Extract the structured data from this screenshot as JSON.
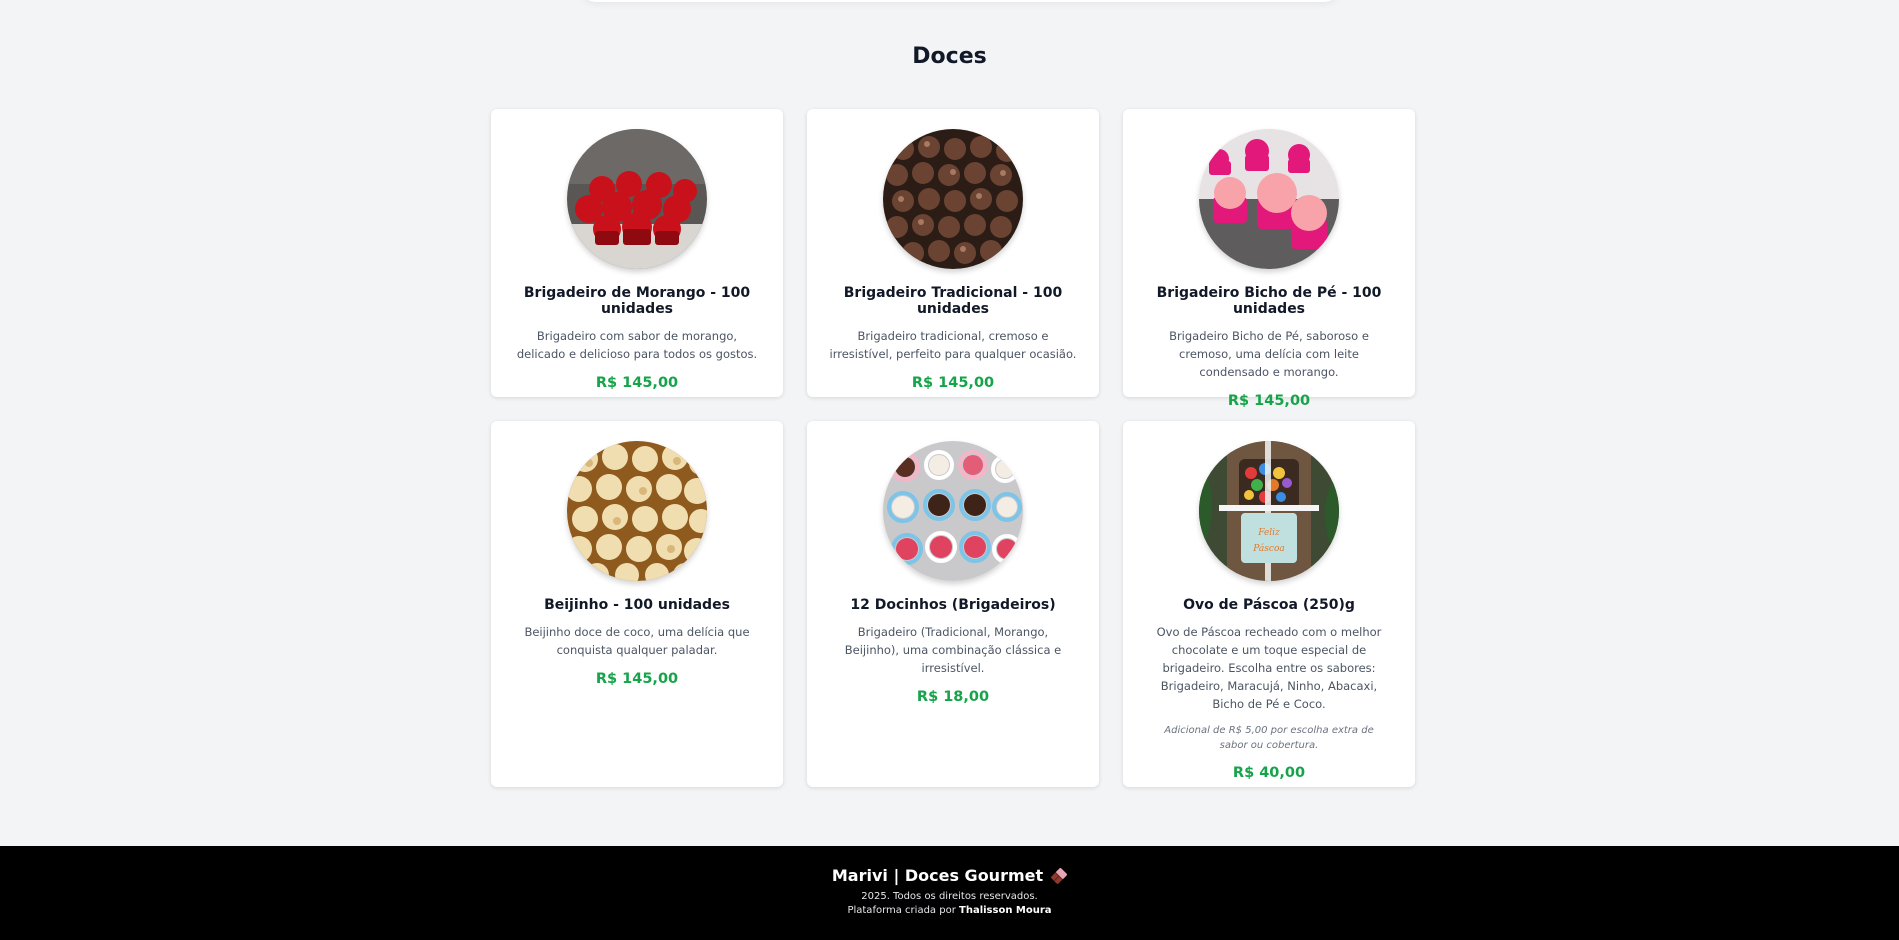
{
  "section": {
    "title": "Doces"
  },
  "products": [
    {
      "name": "Brigadeiro de Morango - 100 unidades",
      "description": "Brigadeiro com sabor de morango, delicado e delicioso para todos os gostos.",
      "price": "R$ 145,00",
      "image": "strawberry-brigadeiro-photo"
    },
    {
      "name": "Brigadeiro Tradicional - 100 unidades",
      "description": "Brigadeiro tradicional, cremoso e irresistível, perfeito para qualquer ocasião.",
      "price": "R$ 145,00",
      "image": "chocolate-brigadeiro-photo"
    },
    {
      "name": "Brigadeiro Bicho de Pé - 100 unidades",
      "description": "Brigadeiro Bicho de Pé, saboroso e cremoso, uma delícia com leite condensado e morango.",
      "price": "R$ 145,00",
      "image": "pink-brigadeiro-photo"
    },
    {
      "name": "Beijinho - 100 unidades",
      "description": "Beijinho doce de coco, uma delícia que conquista qualquer paladar.",
      "price": "R$ 145,00",
      "image": "beijinho-photo"
    },
    {
      "name": "12 Docinhos (Brigadeiros)",
      "description": "Brigadeiro (Tradicional, Morango, Beijinho), uma combinação clássica e irresistível.",
      "price": "R$ 18,00",
      "image": "assorted-sweets-photo"
    },
    {
      "name": "Ovo de Páscoa (250)g",
      "description": "Ovo de Páscoa recheado com o melhor chocolate e um toque especial de brigadeiro. Escolha entre os sabores: Brigadeiro, Maracujá, Ninho, Abacaxi, Bicho de Pé e Coco.",
      "note": "Adicional de R$ 5,00 por escolha extra de sabor ou cobertura.",
      "price": "R$ 40,00",
      "image": "easter-egg-photo"
    }
  ],
  "footer": {
    "brand": "Marivi | Doces Gourmet",
    "brand_icon": "chocolate-bar-icon",
    "copyright": "2025. Todos os direitos reservados.",
    "credit_prefix": "Plataforma criada por",
    "credit_name": "Thalisson Moura"
  },
  "colors": {
    "background": "#f3f4f6",
    "price": "#16a34a",
    "footer": "#000000"
  }
}
